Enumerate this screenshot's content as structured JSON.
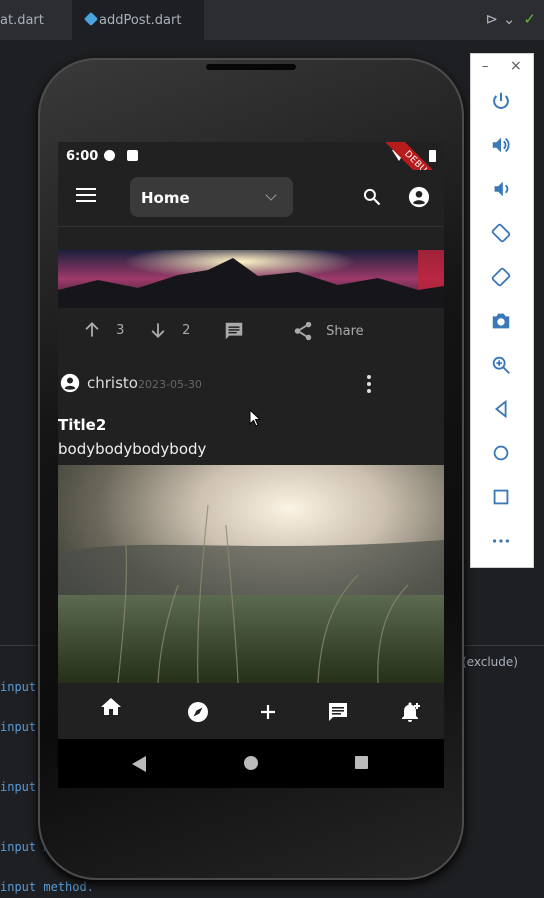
{
  "ide": {
    "tab1": "at.dart",
    "tab2": "addPost.dart",
    "exclude_text": "(exclude)",
    "code_lines": [
      "input",
      "input",
      "input",
      "input m",
      "input method."
    ]
  },
  "phone": {
    "status": {
      "time": "6:00",
      "debug_banner": "DEBUG"
    },
    "appbar": {
      "dropdown_value": "Home"
    },
    "post1": {
      "upvotes": "3",
      "downvotes": "2",
      "share_label": "Share"
    },
    "post2": {
      "author": "christo",
      "date": "2023-05-30",
      "title": "Title2",
      "body": "bodybodybodybody"
    },
    "bottom_nav": [
      "home-icon",
      "explore-icon",
      "add-icon",
      "chat-icon",
      "notification-add-icon"
    ]
  },
  "emulator": {
    "minimize": "–",
    "close": "×",
    "buttons": [
      "power-icon",
      "volume-up-icon",
      "volume-down-icon",
      "rotate-left-icon",
      "rotate-right-icon",
      "camera-icon",
      "zoom-icon",
      "back-icon",
      "home-icon",
      "overview-icon",
      "more-icon"
    ]
  },
  "colors": {
    "accent_green": "#5fb832",
    "debug_red": "#b71c1c",
    "screen_bg": "#212121"
  }
}
